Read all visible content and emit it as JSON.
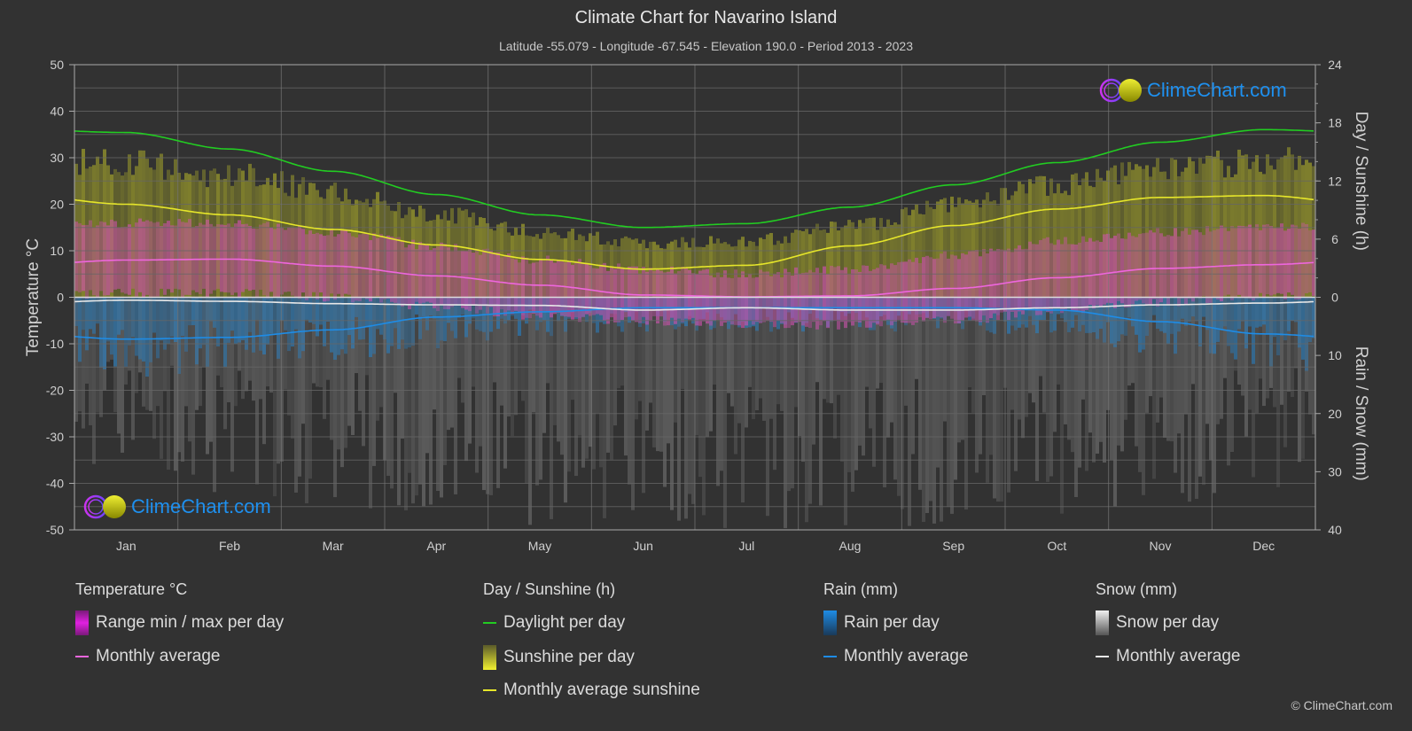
{
  "header": {
    "title": "Climate Chart for Navarino Island",
    "subtitle": "Latitude -55.079 - Longitude -67.545 - Elevation 190.0 - Period 2013 - 2023"
  },
  "chart_data": {
    "type": "line",
    "title": "Climate Chart for Navarino Island",
    "categories": [
      "Jan",
      "Feb",
      "Mar",
      "Apr",
      "May",
      "Jun",
      "Jul",
      "Aug",
      "Sep",
      "Oct",
      "Nov",
      "Dec"
    ],
    "axes": {
      "left": {
        "label": "Temperature °C",
        "ticks": [
          50,
          40,
          30,
          20,
          10,
          0,
          -10,
          -20,
          -30,
          -40,
          -50
        ],
        "range": [
          -50,
          50
        ]
      },
      "right_top": {
        "label": "Day / Sunshine (h)",
        "ticks": [
          24,
          18,
          12,
          6,
          0
        ],
        "range": [
          0,
          24
        ]
      },
      "right_bottom": {
        "label": "Rain / Snow (mm)",
        "ticks": [
          0,
          10,
          20,
          30,
          40
        ],
        "range": [
          0,
          40
        ]
      }
    },
    "grid": true,
    "series": [
      {
        "name": "Daylight per day",
        "unit": "h",
        "axis": "right_top",
        "color": "#22cc22",
        "values": [
          17.0,
          15.3,
          13.0,
          10.6,
          8.5,
          7.2,
          7.6,
          9.3,
          11.6,
          13.9,
          16.0,
          17.3
        ]
      },
      {
        "name": "Monthly average sunshine",
        "unit": "h",
        "axis": "right_top",
        "color": "#e6e62a",
        "values": [
          9.6,
          8.5,
          7.0,
          5.4,
          3.9,
          2.9,
          3.3,
          5.3,
          7.4,
          9.1,
          10.3,
          10.5
        ]
      },
      {
        "name": "Temperature monthly average",
        "unit": "°C",
        "axis": "left",
        "color": "#ee66dd",
        "values": [
          8.0,
          8.2,
          6.7,
          4.6,
          2.6,
          0.5,
          0.1,
          0.3,
          1.9,
          4.2,
          6.2,
          7.0
        ]
      },
      {
        "name": "Rain monthly average",
        "unit": "mm",
        "axis": "right_bottom",
        "color": "#1e8ce6",
        "values": [
          7.2,
          6.9,
          5.6,
          3.4,
          2.5,
          1.8,
          1.8,
          1.8,
          1.8,
          2.2,
          4.2,
          6.3
        ]
      },
      {
        "name": "Snow monthly average",
        "unit": "mm",
        "axis": "right_bottom",
        "color": "#e8e8e8",
        "values": [
          0.5,
          0.7,
          1.1,
          1.3,
          1.4,
          2.2,
          1.8,
          2.2,
          2.2,
          1.8,
          1.3,
          1.0
        ]
      }
    ],
    "daily_ranges": {
      "sunshine_max_h": [
        15.5,
        14.0,
        12.0,
        9.5,
        7.5,
        6.2,
        6.5,
        8.0,
        10.5,
        13.0,
        15.0,
        15.5
      ],
      "temp_min_c": [
        2,
        2,
        1,
        -1,
        -3,
        -4,
        -5,
        -5,
        -4,
        -2,
        0,
        1
      ],
      "temp_max_c": [
        15,
        15,
        13,
        10,
        7,
        5,
        4,
        5,
        8,
        11,
        13,
        14
      ],
      "rain_max_mm": [
        14,
        13,
        11,
        9,
        7,
        6,
        6,
        6,
        6,
        7,
        10,
        12
      ],
      "snow_max_mm": [
        30,
        35,
        36,
        38,
        40,
        40,
        40,
        40,
        40,
        38,
        36,
        34
      ]
    }
  },
  "legend": {
    "groups": [
      {
        "title": "Temperature °C",
        "items": [
          {
            "label": "Range min / max per day",
            "swatch": "box",
            "color": "#e020e0"
          },
          {
            "label": "Monthly average",
            "swatch": "line",
            "color": "#ee66dd"
          }
        ]
      },
      {
        "title": "Day / Sunshine (h)",
        "items": [
          {
            "label": "Daylight per day",
            "swatch": "line",
            "color": "#22cc22"
          },
          {
            "label": "Sunshine per day",
            "swatch": "box",
            "color": "#e6e62a"
          },
          {
            "label": "Monthly average sunshine",
            "swatch": "line",
            "color": "#e6e62a"
          }
        ]
      },
      {
        "title": "Rain (mm)",
        "items": [
          {
            "label": "Rain per day",
            "swatch": "box",
            "color": "#1e8ce6"
          },
          {
            "label": "Monthly average",
            "swatch": "line",
            "color": "#1e8ce6"
          }
        ]
      },
      {
        "title": "Snow (mm)",
        "items": [
          {
            "label": "Snow per day",
            "swatch": "box",
            "color": "#dddddd"
          },
          {
            "label": "Monthly average",
            "swatch": "line",
            "color": "#e8e8e8"
          }
        ]
      }
    ]
  },
  "watermark": {
    "text": "ClimeChart.com"
  },
  "copyright": "© ClimeChart.com"
}
